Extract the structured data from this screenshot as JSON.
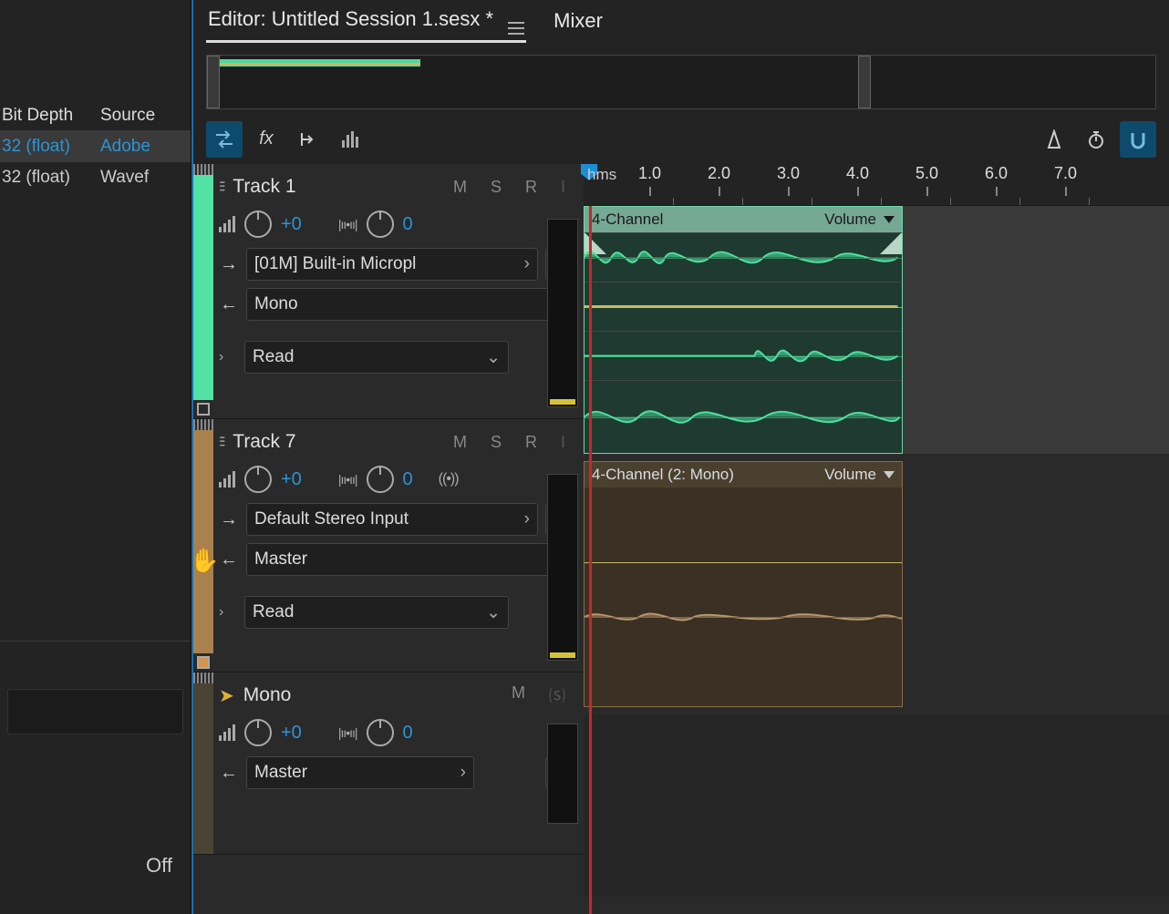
{
  "tabs": {
    "editor": "Editor: Untitled Session 1.sesx *",
    "mixer": "Mixer"
  },
  "files": {
    "headers": {
      "bitdepth": "Bit Depth",
      "source": "Source"
    },
    "rows": [
      {
        "bitdepth": "32 (float)",
        "source": "Adobe"
      },
      {
        "bitdepth": "32 (float)",
        "source": "Wavef"
      }
    ],
    "off_label": "Off"
  },
  "ruler": {
    "unit": "hms",
    "ticks": [
      "1.0",
      "2.0",
      "3.0",
      "4.0",
      "5.0",
      "6.0",
      "7.0"
    ]
  },
  "tracks": [
    {
      "id": "t1",
      "name": "Track 1",
      "msr": {
        "m": "M",
        "s": "S",
        "r": "R",
        "i": "I"
      },
      "vol": "+0",
      "pan": "0",
      "input": "[01M] Built-in Micropl",
      "output": "Mono",
      "automation": "Read",
      "clip": {
        "title": "4-Channel",
        "vol_label": "Volume"
      }
    },
    {
      "id": "t7",
      "name": "Track 7",
      "msr": {
        "m": "M",
        "s": "S",
        "r": "R",
        "i": "I"
      },
      "vol": "+0",
      "pan": "0",
      "input": "Default Stereo Input",
      "output": "Master",
      "automation": "Read",
      "clip": {
        "title": "4-Channel (2: Mono)",
        "vol_label": "Volume"
      }
    },
    {
      "id": "bus",
      "name": "Mono",
      "msr": {
        "m": "M",
        "s": "⒮"
      },
      "vol": "+0",
      "pan": "0",
      "output": "Master"
    }
  ]
}
